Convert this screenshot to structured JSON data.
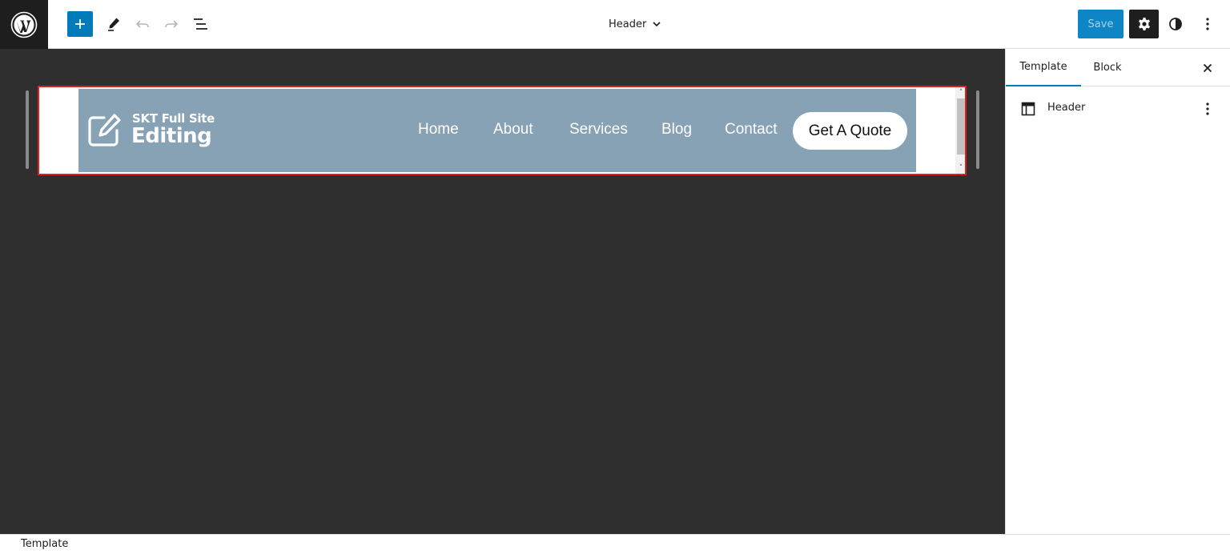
{
  "toolbar": {
    "add_icon": "plus-icon",
    "tools_icon": "pencil-icon",
    "undo_icon": "undo-icon",
    "redo_icon": "redo-icon",
    "list_view_icon": "list-view-icon",
    "document_title": "Header",
    "save_label": "Save",
    "settings_icon": "gear-icon",
    "styles_icon": "half-circle-icon",
    "options_icon": "vertical-ellipsis-icon"
  },
  "site_header": {
    "logo_line1": "SKT Full Site",
    "logo_line2": "Editing",
    "nav": [
      "Home",
      "About",
      "Services",
      "Blog",
      "Contact"
    ],
    "cta_label": "Get A Quote",
    "background": "#87a1b5"
  },
  "sidebar": {
    "tabs": [
      "Template",
      "Block"
    ],
    "active_tab": "Template",
    "close_icon": "close-icon",
    "template_item": {
      "icon": "layout-icon",
      "label": "Header",
      "more_icon": "vertical-ellipsis-icon"
    }
  },
  "footer": {
    "breadcrumb": "Template"
  },
  "colors": {
    "accent": "#007cba",
    "canvas_bg": "#2f2f2f",
    "selection_outline": "#e0201c"
  }
}
